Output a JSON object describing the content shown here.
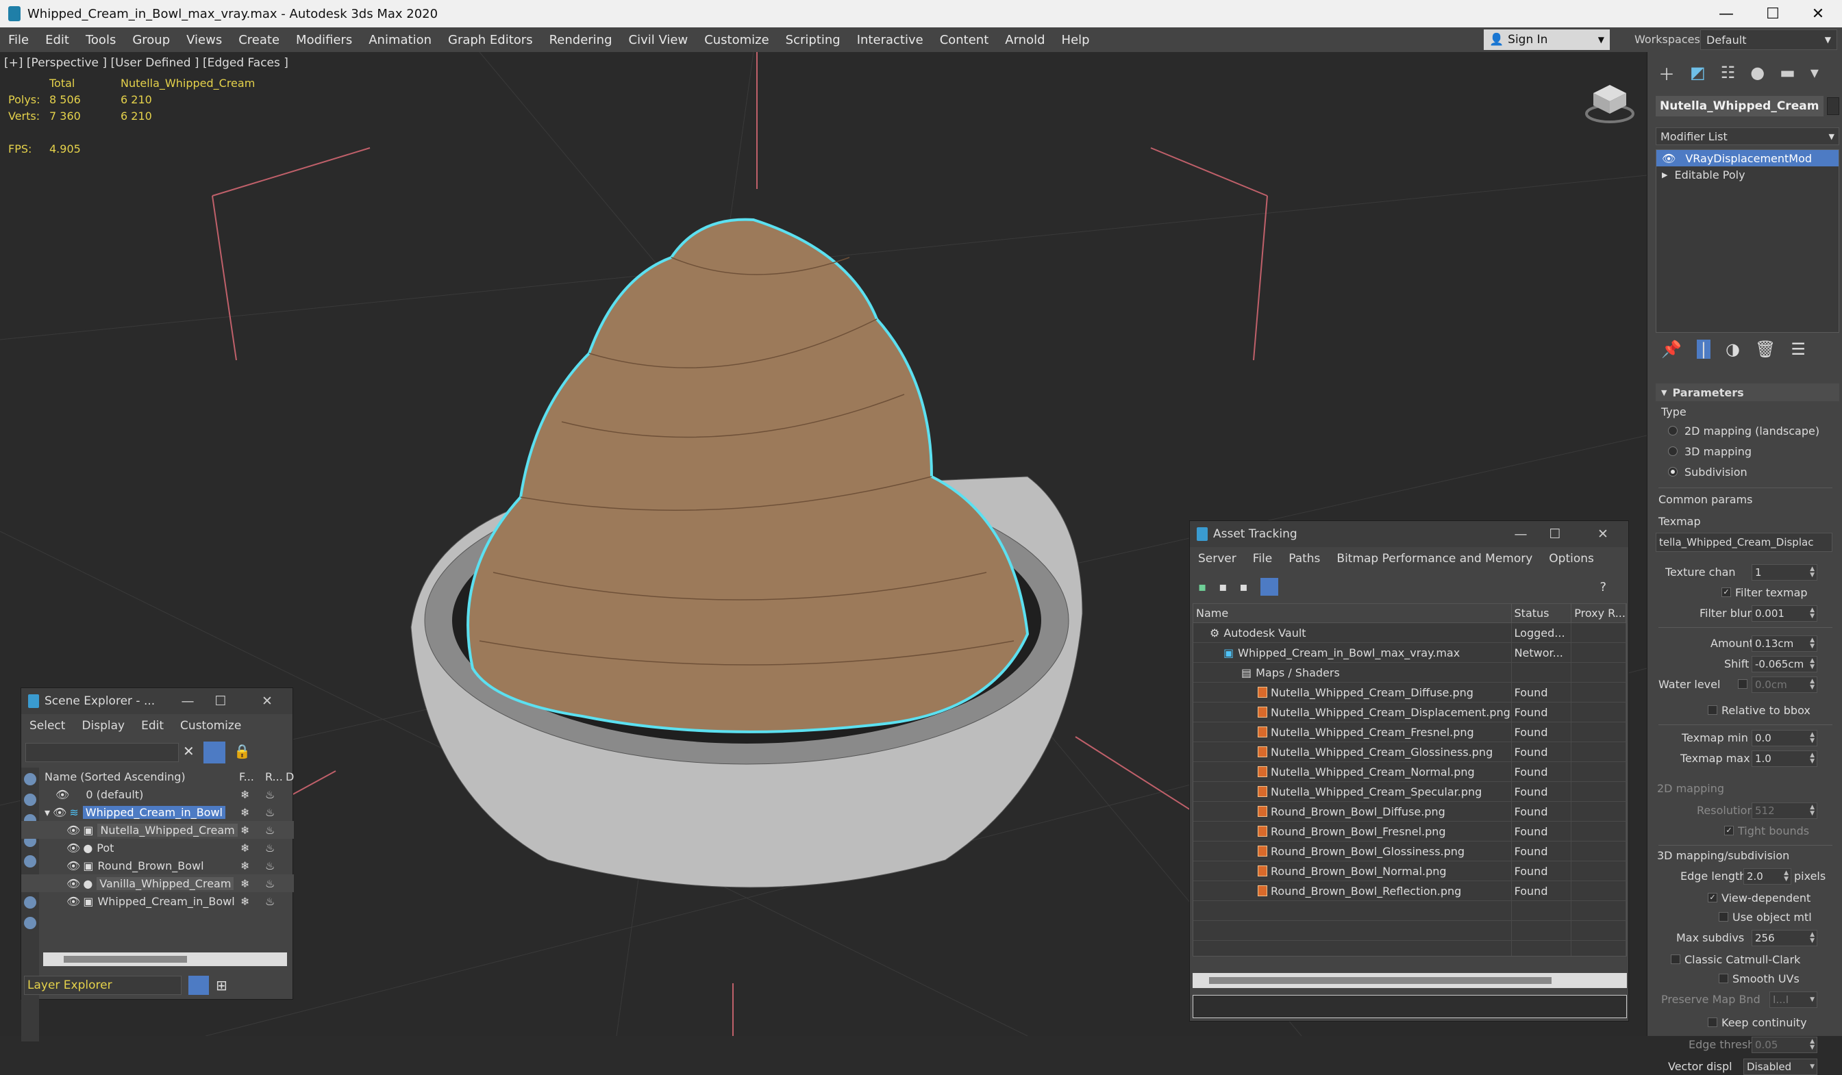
{
  "window": {
    "title": "Whipped_Cream_in_Bowl_max_vray.max - Autodesk 3ds Max 2020",
    "min": "—",
    "max": "☐",
    "close": "✕"
  },
  "menu": [
    "File",
    "Edit",
    "Tools",
    "Group",
    "Views",
    "Create",
    "Modifiers",
    "Animation",
    "Graph Editors",
    "Rendering",
    "Civil View",
    "Customize",
    "Scripting",
    "Interactive",
    "Content",
    "Arnold",
    "Help"
  ],
  "signin": {
    "label": "Sign In"
  },
  "workspaces": {
    "label": "Workspaces:",
    "value": "Default"
  },
  "viewport": {
    "label": "[+] [Perspective ] [User Defined ] [Edged Faces ]",
    "stats": {
      "total_label": "Total",
      "object": "Nutella_Whipped_Cream",
      "polys_label": "Polys:",
      "polys_total": "8 506",
      "polys_obj": "6 210",
      "verts_label": "Verts:",
      "verts_total": "7 360",
      "verts_obj": "6 210",
      "fps_label": "FPS:",
      "fps": "4.905"
    }
  },
  "command_panel": {
    "object_name": "Nutella_Whipped_Cream",
    "modifier_list": "Modifier List",
    "stack": [
      "VRayDisplacementMod",
      "Editable Poly"
    ],
    "rollout": "Parameters",
    "type_label": "Type",
    "type_options": [
      "2D mapping (landscape)",
      "3D mapping",
      "Subdivision"
    ],
    "type_selected": 2,
    "common_params": "Common params",
    "texmap_label": "Texmap",
    "texmap_value": "tella_Whipped_Cream_Displac",
    "texture_chan_label": "Texture chan",
    "texture_chan": "1",
    "filter_texmap": "Filter texmap",
    "filter_blur_label": "Filter blur",
    "filter_blur": "0.001",
    "amount_label": "Amount",
    "amount": "0.13cm",
    "shift_label": "Shift",
    "shift": "-0.065cm",
    "water_level_label": "Water level",
    "water_level": "0.0cm",
    "relative_bbox": "Relative to bbox",
    "texmap_min_label": "Texmap min",
    "texmap_min": "0.0",
    "texmap_max_label": "Texmap max",
    "texmap_max": "1.0",
    "mapping2d": "2D mapping",
    "resolution_label": "Resolution",
    "resolution": "512",
    "tight_bounds": "Tight bounds",
    "mapping3d": "3D mapping/subdivision",
    "edge_length_label": "Edge length",
    "edge_length": "2.0",
    "pixels": "pixels",
    "view_dependent": "View-dependent",
    "use_object_mtl": "Use object mtl",
    "max_subdivs_label": "Max subdivs",
    "max_subdivs": "256",
    "catmull": "Classic Catmull-Clark",
    "smooth_uvs": "Smooth UVs",
    "preserve_label": "Preserve Map Bnd",
    "preserve": "I...I",
    "keep_continuity": "Keep continuity",
    "edge_thresh_label": "Edge thresh",
    "edge_thresh": "0.05",
    "vector_displ_label": "Vector displ",
    "vector_displ": "Disabled"
  },
  "scene_explorer": {
    "title": "Scene Explorer - ...",
    "menu": [
      "Select",
      "Display",
      "Edit",
      "Customize"
    ],
    "col_name": "Name (Sorted Ascending)",
    "col_f": "F...",
    "col_r": "R...",
    "col_d": "D",
    "rows": [
      "0 (default)",
      "Whipped_Cream_in_Bowl",
      "Nutella_Whipped_Cream",
      "Pot",
      "Round_Brown_Bowl",
      "Vanilla_Whipped_Cream",
      "Whipped_Cream_in_Bowl"
    ],
    "footer": "Layer Explorer"
  },
  "asset_tracking": {
    "title": "Asset Tracking",
    "menu": [
      "Server",
      "File",
      "Paths",
      "Bitmap Performance and Memory",
      "Options"
    ],
    "columns": [
      "Name",
      "Status",
      "Proxy R..."
    ],
    "rows": [
      {
        "name": "Autodesk Vault",
        "status": "Logged..."
      },
      {
        "name": "Whipped_Cream_in_Bowl_max_vray.max",
        "status": "Networ..."
      },
      {
        "name": "Maps / Shaders",
        "status": ""
      },
      {
        "name": "Nutella_Whipped_Cream_Diffuse.png",
        "status": "Found"
      },
      {
        "name": "Nutella_Whipped_Cream_Displacement.png",
        "status": "Found"
      },
      {
        "name": "Nutella_Whipped_Cream_Fresnel.png",
        "status": "Found"
      },
      {
        "name": "Nutella_Whipped_Cream_Glossiness.png",
        "status": "Found"
      },
      {
        "name": "Nutella_Whipped_Cream_Normal.png",
        "status": "Found"
      },
      {
        "name": "Nutella_Whipped_Cream_Specular.png",
        "status": "Found"
      },
      {
        "name": "Round_Brown_Bowl_Diffuse.png",
        "status": "Found"
      },
      {
        "name": "Round_Brown_Bowl_Fresnel.png",
        "status": "Found"
      },
      {
        "name": "Round_Brown_Bowl_Glossiness.png",
        "status": "Found"
      },
      {
        "name": "Round_Brown_Bowl_Normal.png",
        "status": "Found"
      },
      {
        "name": "Round_Brown_Bowl_Reflection.png",
        "status": "Found"
      }
    ]
  }
}
